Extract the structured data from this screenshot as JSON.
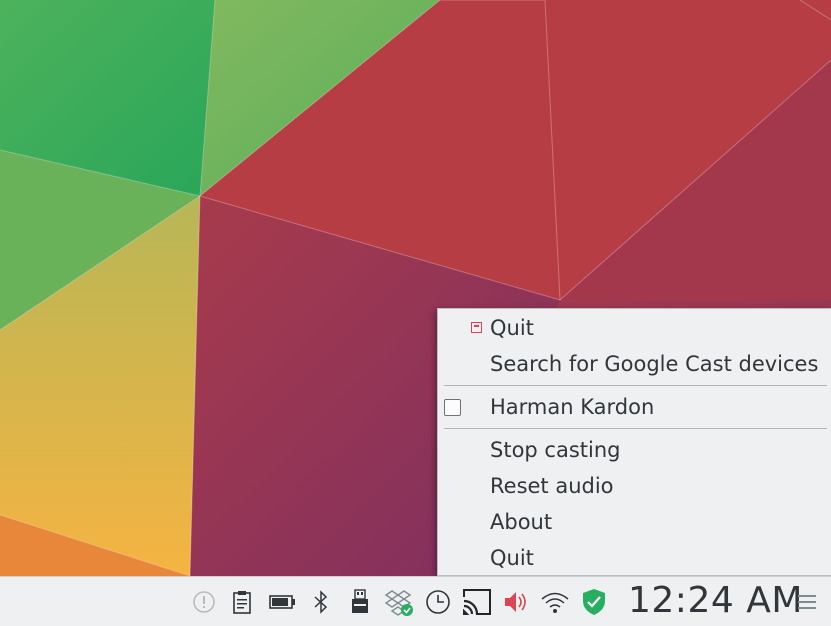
{
  "menu": {
    "app_title": "Quit",
    "search": "Search for Google Cast devices",
    "device": "Harman Kardon",
    "device_checked": false,
    "stop": "Stop casting",
    "reset": "Reset audio",
    "about": "About",
    "quit": "Quit"
  },
  "taskbar": {
    "clock": "12:24 AM",
    "tray_icons": [
      "notifications-icon",
      "clipboard-icon",
      "battery-icon",
      "bluetooth-icon",
      "usb-drive-icon",
      "dropbox-icon",
      "clock-icon",
      "cast-icon",
      "volume-icon",
      "wifi-icon",
      "shield-icon"
    ]
  },
  "colors": {
    "menu_bg": "#eff0f1",
    "text": "#31363b",
    "accent_red": "#da4453",
    "shield_green": "#27ae60"
  }
}
